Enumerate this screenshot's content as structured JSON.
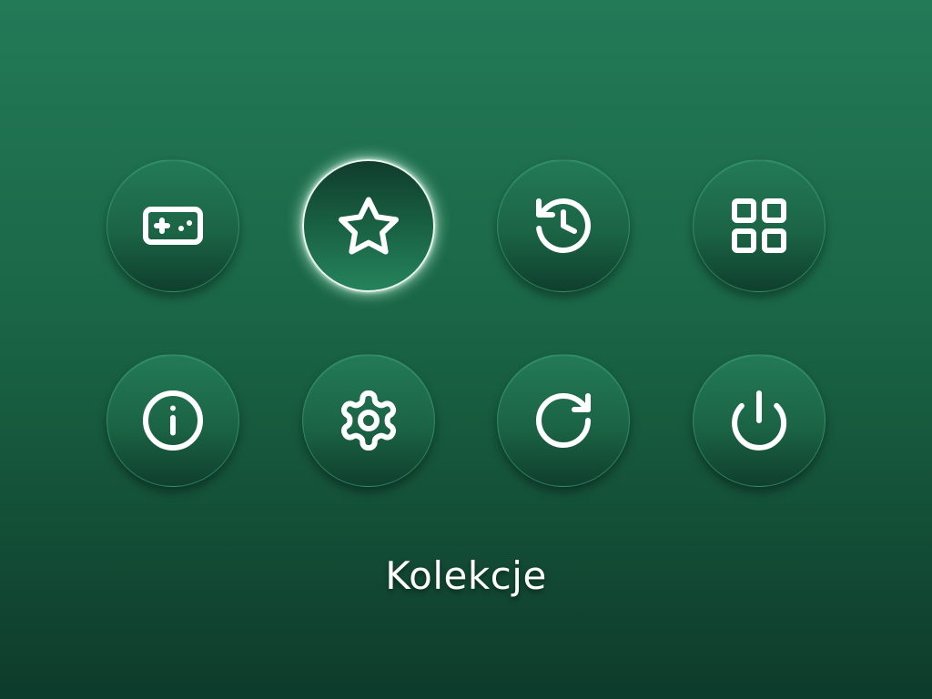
{
  "menu": {
    "selected_caption": "Kolekcje",
    "items": [
      {
        "icon": "gamepad-icon",
        "selected": false
      },
      {
        "icon": "star-icon",
        "selected": true
      },
      {
        "icon": "history-icon",
        "selected": false
      },
      {
        "icon": "grid-icon",
        "selected": false
      },
      {
        "icon": "info-icon",
        "selected": false
      },
      {
        "icon": "gear-icon",
        "selected": false
      },
      {
        "icon": "refresh-icon",
        "selected": false
      },
      {
        "icon": "power-icon",
        "selected": false
      }
    ]
  },
  "colors": {
    "background_top": "#237a57",
    "background_bottom": "#0e3b2b",
    "icon": "#ffffff",
    "selected_glow": "#d2ffe6"
  }
}
